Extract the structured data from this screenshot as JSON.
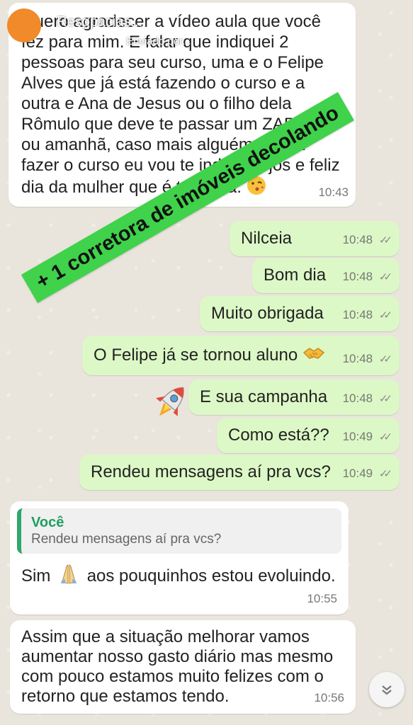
{
  "story": {
    "overlay_top": "Resgpacias...",
    "overlay_sub": "Enviado por..."
  },
  "sticker_text": "+ 1 corretora de imóveis decolando",
  "messages": [
    {
      "id": "m1",
      "dir": "in",
      "text": "Quero agradecer a vídeo aula que você fez para mim. E falar que indiquei 2 pessoas para seu curso, uma e o Felipe Alves que já está fazendo o curso e a outra e Ana de Jesus ou o filho dela Rômulo que deve te passar um ZAP hoje ou amanhã, caso mais alguém queira fazer o curso eu vou te indicar. Bjos e feliz dia da mulher que é todo dia.",
      "time": "10:43"
    },
    {
      "id": "m2",
      "dir": "out",
      "text": "Nilceia",
      "time": "10:48"
    },
    {
      "id": "m3",
      "dir": "out",
      "text": "Bom dia",
      "time": "10:48"
    },
    {
      "id": "m4",
      "dir": "out",
      "text": "Muito obrigada",
      "time": "10:48"
    },
    {
      "id": "m5",
      "dir": "out",
      "text": "O Felipe já se tornou aluno",
      "time": "10:48"
    },
    {
      "id": "m6",
      "dir": "out",
      "text": "E sua campanha",
      "time": "10:48"
    },
    {
      "id": "m7",
      "dir": "out",
      "text": "Como está??",
      "time": "10:49"
    },
    {
      "id": "m8",
      "dir": "out",
      "text": "Rendeu mensagens aí pra vcs?",
      "time": "10:49"
    },
    {
      "id": "m9",
      "dir": "in",
      "quote_name": "Você",
      "quote_text": "Rendeu mensagens aí pra vcs?",
      "text_before": "Sim",
      "text_after": "aos pouquinhos estou evoluindo.",
      "time": "10:55"
    },
    {
      "id": "m10",
      "dir": "in",
      "text": "Assim que a situação melhorar vamos aumentar nosso gasto diário mas mesmo com pouco estamos muito felizes com o retorno que estamos tendo.",
      "time": "10:56"
    }
  ],
  "colors": {
    "incoming": "#ffffff",
    "outgoing": "#dcf8c6",
    "sticker": "#3fd24a",
    "quote_accent": "#1f9e62",
    "story_dot": "#f08a2a"
  },
  "icons": [
    "kiss-emoji",
    "handshake-emoji",
    "rocket-emoji",
    "praying-hands-emoji",
    "double-check-icon",
    "scroll-down-icon"
  ]
}
